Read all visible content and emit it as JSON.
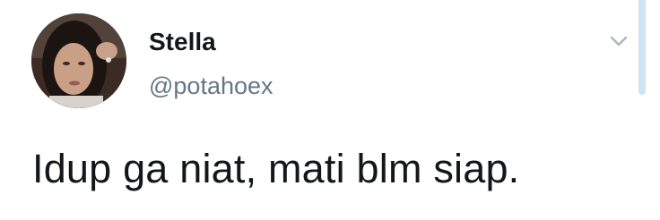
{
  "tweet": {
    "author": {
      "display_name": "Stella",
      "handle": "@potahoex",
      "avatar_icon": "profile-photo"
    },
    "text": "Idup ga niat, mati blm siap.",
    "menu_icon": "chevron-down-icon"
  },
  "colors": {
    "text_primary": "#14171a",
    "text_secondary": "#657786",
    "caret": "#aab8c2",
    "scrollbar": "#cfe3f3",
    "background": "#ffffff"
  }
}
